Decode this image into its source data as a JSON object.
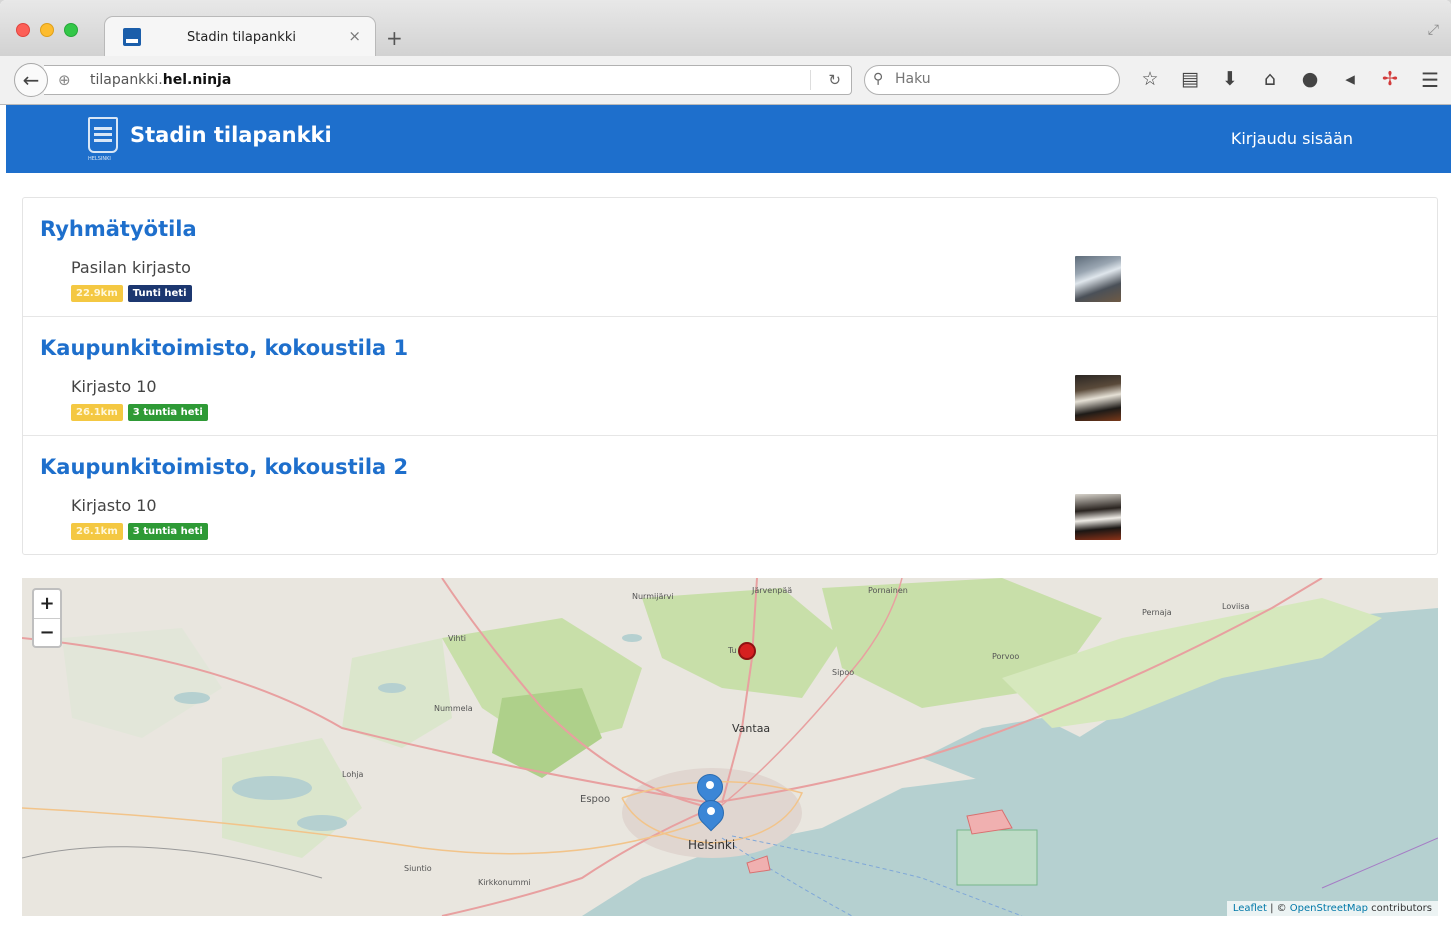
{
  "browser": {
    "tab_title": "Stadin tilapankki",
    "tab_close": "×",
    "new_tab": "+",
    "url_plain": "tilapankki.",
    "url_bold": "hel.ninja",
    "search_placeholder": "Haku"
  },
  "header": {
    "logo_sub": "HELSINKI",
    "title": "Stadin tilapankki",
    "login": "Kirjaudu sisään"
  },
  "results": [
    {
      "title": "Ryhmätyötila",
      "location": "Pasilan kirjasto",
      "distance": "22.9km",
      "availability": "Tunti heti",
      "availability_color": "#1c3770"
    },
    {
      "title": "Kaupunkitoimisto, kokoustila 1",
      "location": "Kirjasto 10",
      "distance": "26.1km",
      "availability": "3 tuntia heti",
      "availability_color": "#2e9a36"
    },
    {
      "title": "Kaupunkitoimisto, kokoustila 2",
      "location": "Kirjasto 10",
      "distance": "26.1km",
      "availability": "3 tuntia heti",
      "availability_color": "#2e9a36"
    }
  ],
  "map": {
    "zoom_in": "+",
    "zoom_out": "−",
    "places": {
      "nurmijarvi": "Nurmijärvi",
      "jarvenpaa": "Järvenpää",
      "pornainen": "Pornainen",
      "pernaja": "Pernaja",
      "loviisa": "Loviisa",
      "vihti": "Vihti",
      "tuusula": "Tu",
      "sipoo": "Sipoo",
      "porvoo": "Porvoo",
      "nummela": "Nummela",
      "vantaa": "Vantaa",
      "lohja": "Lohja",
      "espoo": "Espoo",
      "helsinki": "Helsinki",
      "siuntio": "Siuntio",
      "kirkkonummi": "Kirkkonummi"
    },
    "attribution_leaflet": "Leaflet",
    "attribution_sep": " | © ",
    "attribution_osm": "OpenStreetMap",
    "attribution_tail": " contributors"
  },
  "colors": {
    "brand": "#1e6fcc",
    "distance_badge": "#f4c842"
  }
}
